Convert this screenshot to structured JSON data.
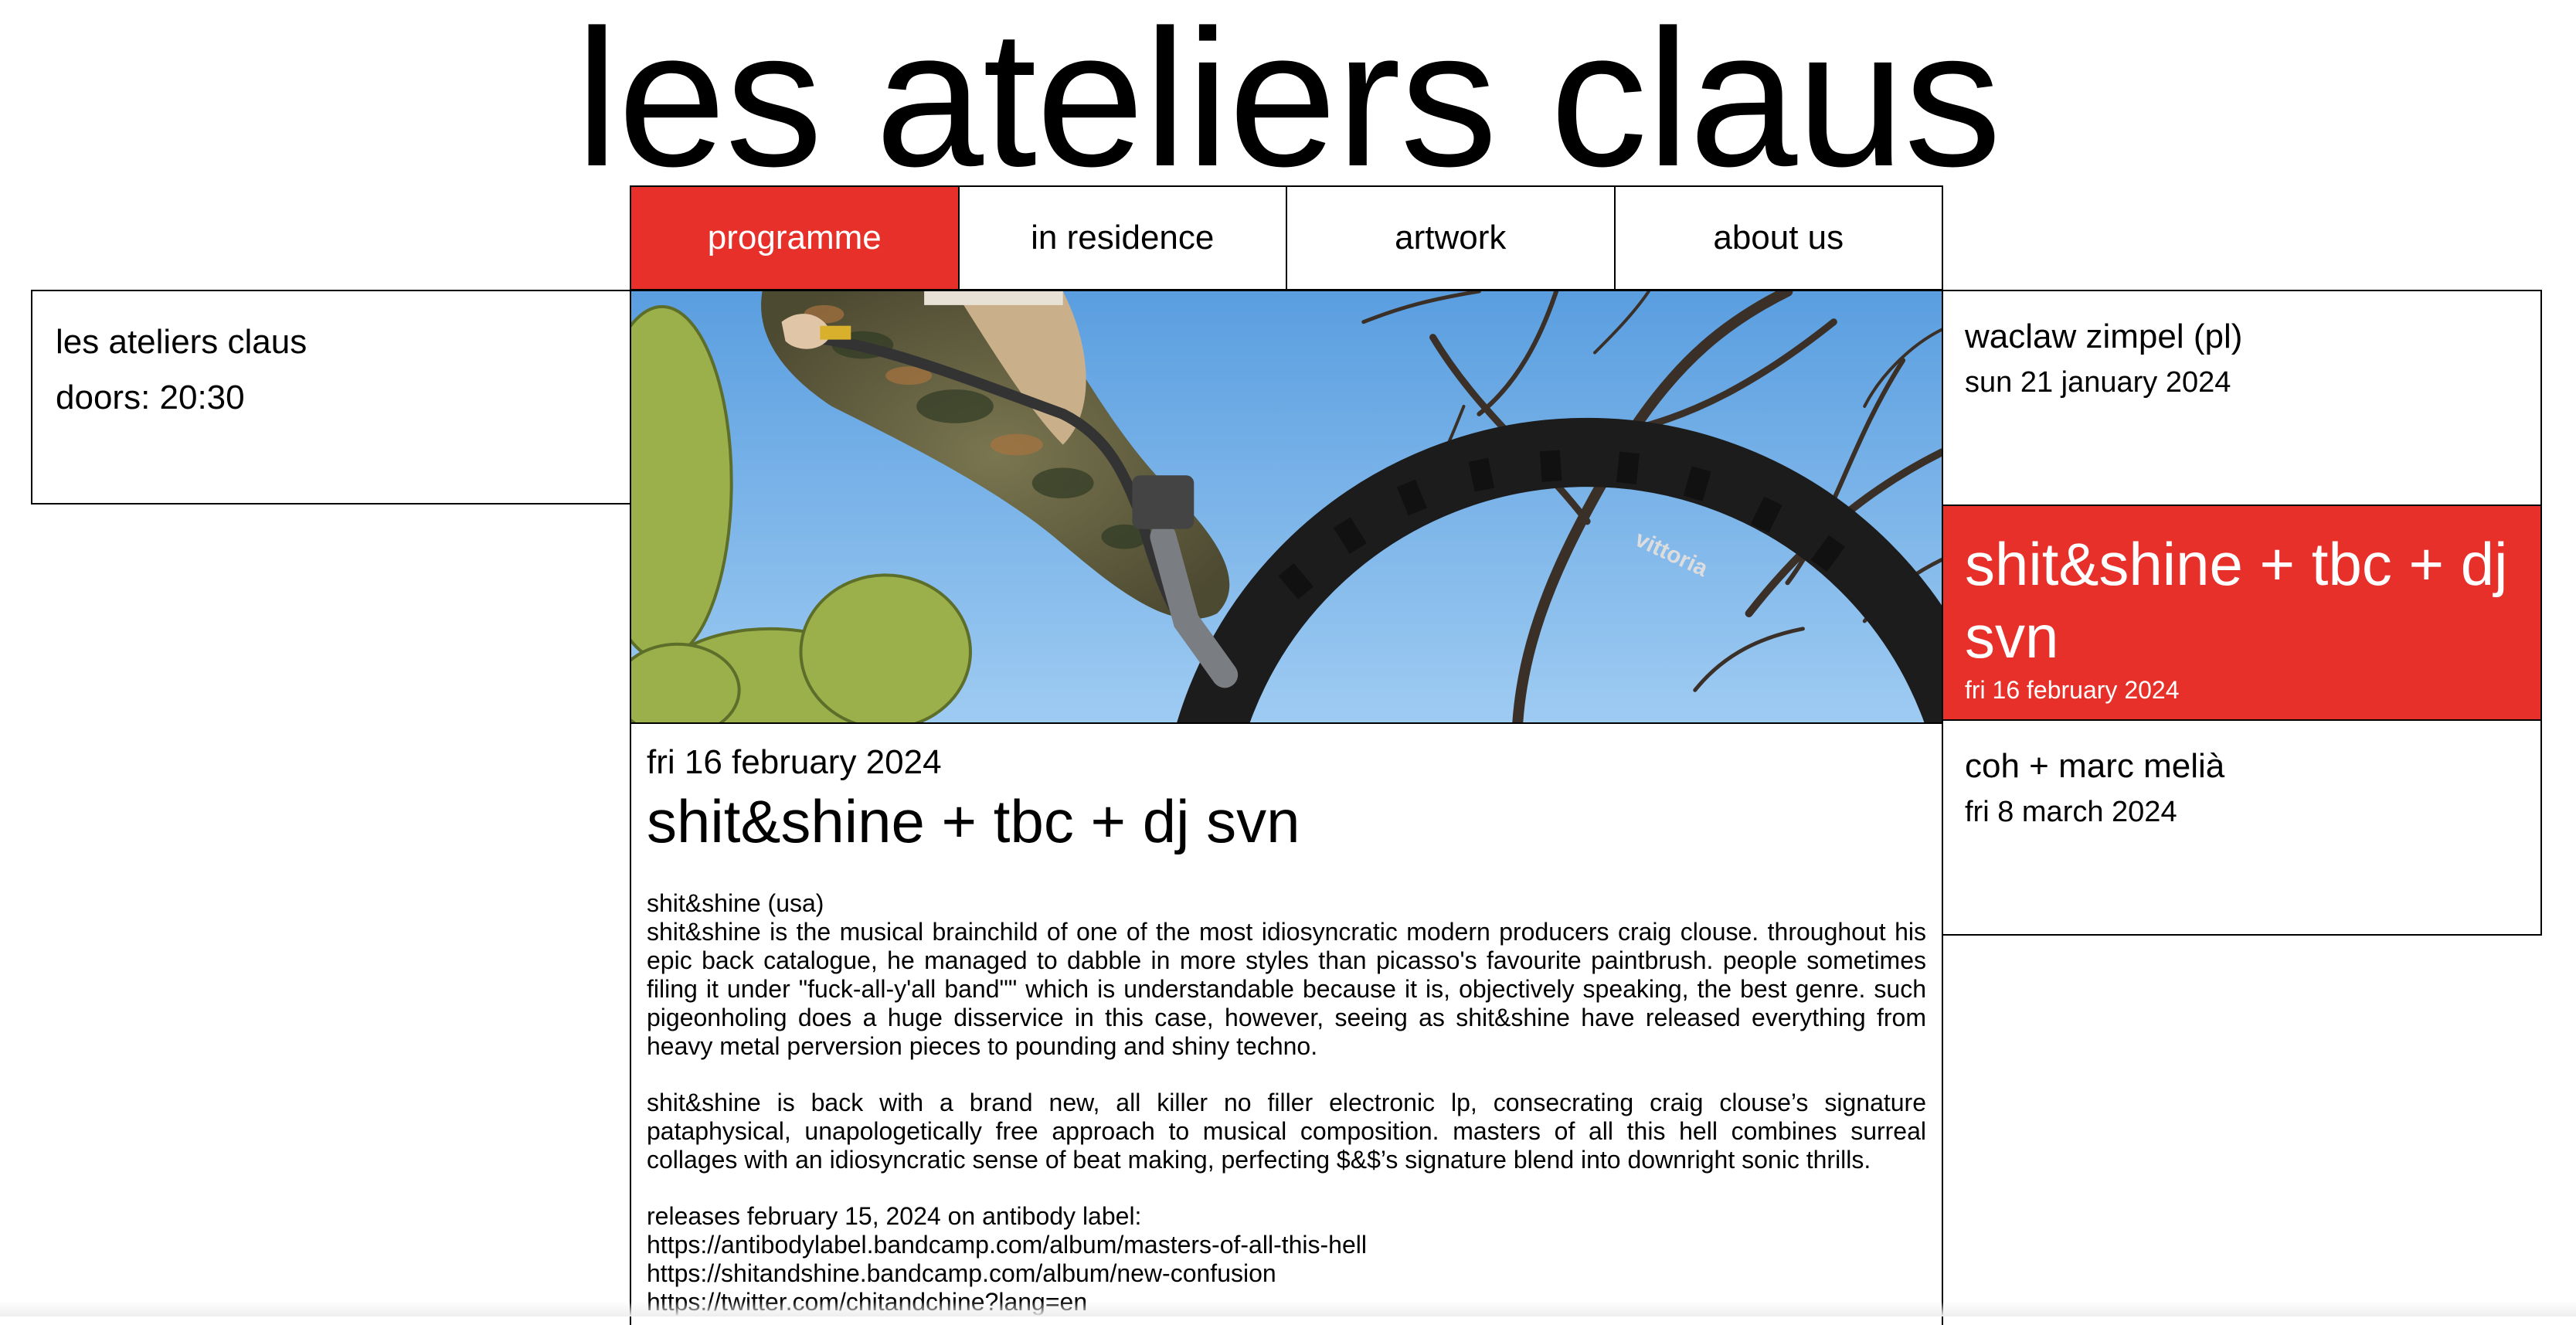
{
  "site": {
    "title": "les ateliers claus"
  },
  "nav": {
    "tabs": [
      {
        "label": "programme",
        "active": true
      },
      {
        "label": "in residence",
        "active": false
      },
      {
        "label": "artwork",
        "active": false
      },
      {
        "label": "about us",
        "active": false
      }
    ]
  },
  "venue": {
    "name": "les ateliers claus",
    "doors": "doors: 20:30"
  },
  "article": {
    "date": "fri 16 february 2024",
    "title": "shit&shine + tbc + dj svn",
    "paragraphs": [
      "shit&shine (usa)",
      "shit&shine is the musical brainchild of one of the most idiosyncratic modern producers craig clouse. throughout his epic back catalogue, he managed to dabble in more styles than picasso's favourite paintbrush. people sometimes filing it under \"fuck-all-y'all band\"\" which is understandable because it is, objectively speaking, the best genre. such pigeonholing does a huge disservice in this case, however, seeing as shit&shine have released everything from heavy metal perversion pieces to pounding and shiny techno.",
      "shit&shine is back with a brand new, all killer no filler electronic lp, consecrating craig clouse’s signature pataphysical, unapologetically free approach to musical composition. masters of all this hell combines surreal collages with an idiosyncratic sense of beat making, perfecting $&$’s signature blend into downright sonic thrills.",
      "releases february 15, 2024 on antibody label:",
      "https://antibodylabel.bandcamp.com/album/masters-of-all-this-hell",
      "https://shitandshine.bandcamp.com/album/new-confusion",
      "https://twitter.com/chitandchine?lang=en"
    ]
  },
  "events": [
    {
      "title": "waclaw zimpel (pl)",
      "date": "sun 21 january 2024",
      "active": false
    },
    {
      "title": "shit&shine + tbc + dj svn",
      "date": "fri 16 february 2024",
      "active": true
    },
    {
      "title": "coh + marc melià",
      "date": "fri 8 march 2024",
      "active": false
    }
  ],
  "hero": {
    "tire_brand": "vittoria"
  },
  "colors": {
    "accent": "#e8302a",
    "sky": "#6fb1e8"
  }
}
